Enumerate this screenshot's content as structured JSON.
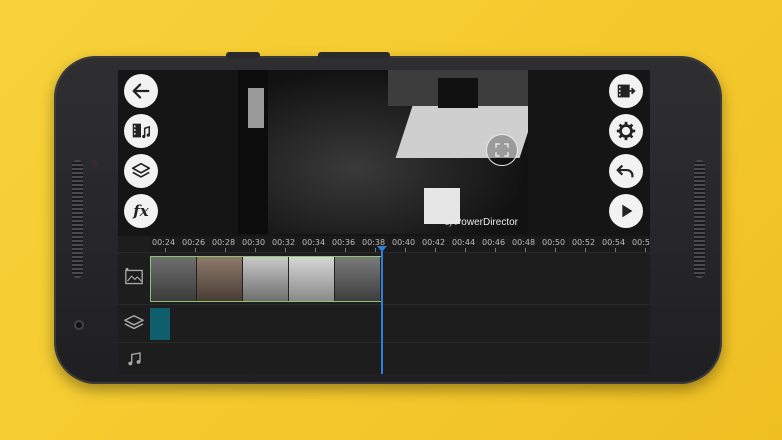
{
  "app": {
    "watermark_prefix": "by",
    "watermark_brand": "PowerDirector"
  },
  "left_toolbar": {
    "icons": [
      "back-arrow-icon",
      "media-library-icon",
      "layers-icon",
      "fx-icon"
    ],
    "fx_label": "fx"
  },
  "right_toolbar": {
    "icons": [
      "export-produce-icon",
      "settings-gear-icon",
      "undo-icon",
      "play-icon"
    ]
  },
  "timeline": {
    "labels": [
      "00:24",
      "00:26",
      "00:28",
      "00:30",
      "00:32",
      "00:34",
      "00:36",
      "00:38",
      "00:40",
      "00:42",
      "00:44",
      "00:46",
      "00:48",
      "00:50",
      "00:52",
      "00:54",
      "00:5"
    ],
    "tracks": [
      "video-track-icon",
      "overlay-track-icon",
      "audio-track-icon"
    ]
  },
  "colors": {
    "accent": "#2d7fd9",
    "clip_border": "#8fc46f",
    "overlay_clip": "#0e5f6b",
    "background": "#f4c82c"
  }
}
